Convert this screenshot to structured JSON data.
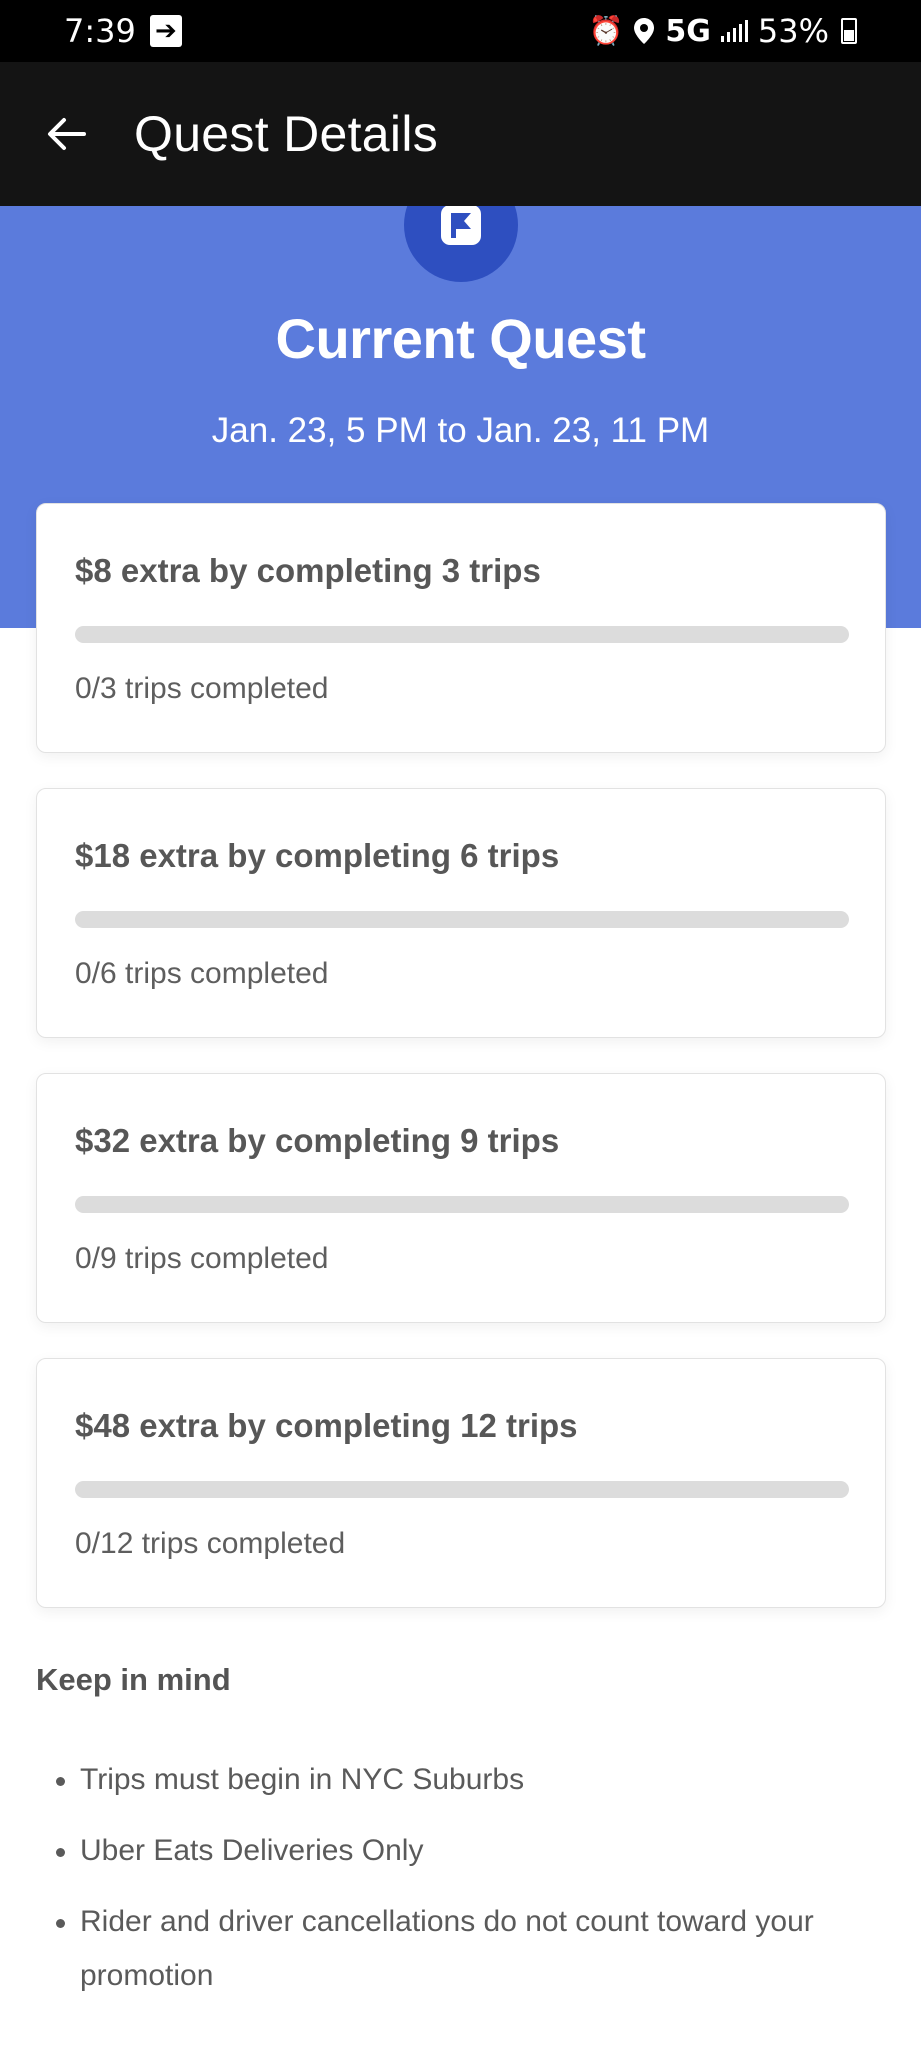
{
  "status_bar": {
    "time": "7:39",
    "network": "5G",
    "battery": "53%",
    "icons": [
      "cast-icon",
      "alarm-icon",
      "location-icon",
      "signal-icon",
      "battery-icon"
    ]
  },
  "app_bar": {
    "title": "Quest Details",
    "back_icon": "arrow-left-icon"
  },
  "hero": {
    "badge_icon": "flag-icon",
    "title": "Current Quest",
    "date_range": "Jan. 23, 5 PM to Jan. 23, 11 PM"
  },
  "quests": [
    {
      "title": "$8 extra by completing 3 trips",
      "completed": 0,
      "required": 3,
      "status": "0/3 trips completed"
    },
    {
      "title": "$18 extra by completing 6 trips",
      "completed": 0,
      "required": 6,
      "status": "0/6 trips completed"
    },
    {
      "title": "$32 extra by completing 9 trips",
      "completed": 0,
      "required": 9,
      "status": "0/9 trips completed"
    },
    {
      "title": "$48 extra by completing 12 trips",
      "completed": 0,
      "required": 12,
      "status": "0/12 trips completed"
    }
  ],
  "keep_in_mind": {
    "title": "Keep in mind",
    "items": [
      "Trips must begin in NYC Suburbs",
      "Uber Eats Deliveries Only",
      "Rider and driver cancellations do not count toward your promotion"
    ]
  },
  "colors": {
    "hero_background": "#5b7bdc",
    "badge_background": "#2e4fc0",
    "app_bar_background": "#141414",
    "progress_track": "#dcdcdc"
  }
}
